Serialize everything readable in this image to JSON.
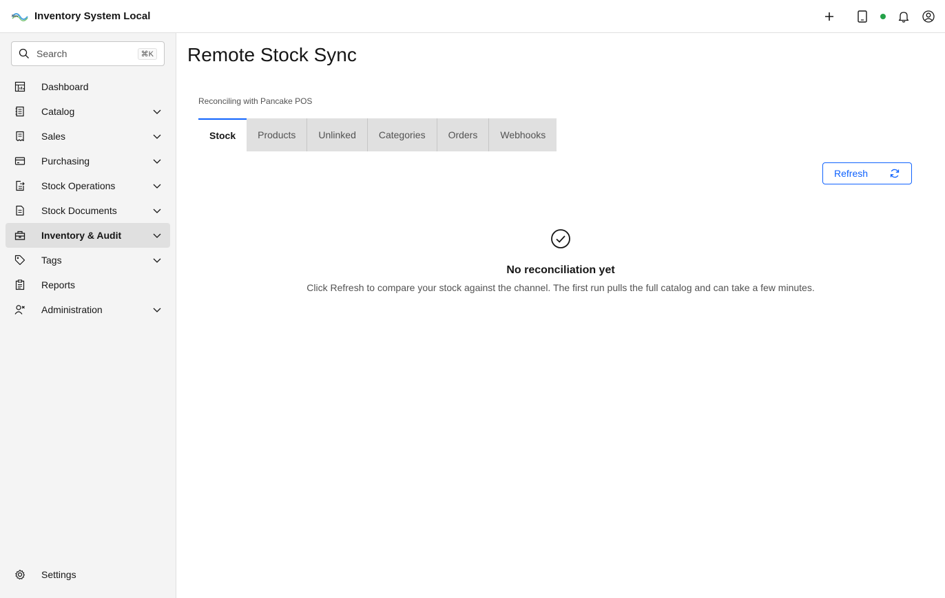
{
  "header": {
    "app_title": "Inventory System Local",
    "status_color": "#24a148",
    "icons": [
      "add-icon",
      "tablet-icon",
      "notification-icon",
      "user-avatar-icon"
    ]
  },
  "sidebar": {
    "search": {
      "placeholder": "Search",
      "shortcut": "⌘K"
    },
    "items": [
      {
        "label": "Dashboard",
        "icon": "dashboard-icon",
        "expandable": false
      },
      {
        "label": "Catalog",
        "icon": "catalog-icon",
        "expandable": true
      },
      {
        "label": "Sales",
        "icon": "sales-icon",
        "expandable": true
      },
      {
        "label": "Purchasing",
        "icon": "purchasing-icon",
        "expandable": true
      },
      {
        "label": "Stock Operations",
        "icon": "stock-operations-icon",
        "expandable": true
      },
      {
        "label": "Stock Documents",
        "icon": "document-icon",
        "expandable": true
      },
      {
        "label": "Inventory & Audit",
        "icon": "inventory-icon",
        "expandable": true,
        "active": true
      },
      {
        "label": "Tags",
        "icon": "tag-icon",
        "expandable": true
      },
      {
        "label": "Reports",
        "icon": "report-icon",
        "expandable": false
      },
      {
        "label": "Administration",
        "icon": "administration-icon",
        "expandable": true
      }
    ],
    "settings_label": "Settings"
  },
  "main": {
    "title": "Remote Stock Sync",
    "subtitle": "Reconciling with Pancake POS",
    "tabs": [
      {
        "label": "Stock",
        "active": true
      },
      {
        "label": "Products"
      },
      {
        "label": "Unlinked"
      },
      {
        "label": "Categories"
      },
      {
        "label": "Orders"
      },
      {
        "label": "Webhooks"
      }
    ],
    "refresh_label": "Refresh",
    "empty_state": {
      "title": "No reconciliation yet",
      "description": "Click Refresh to compare your stock against the channel. The first run pulls the full catalog and can take a few minutes."
    }
  },
  "colors": {
    "accent": "#0f62fe",
    "sidebar_bg": "#f4f4f4",
    "active_bg": "#e0e0e0"
  }
}
